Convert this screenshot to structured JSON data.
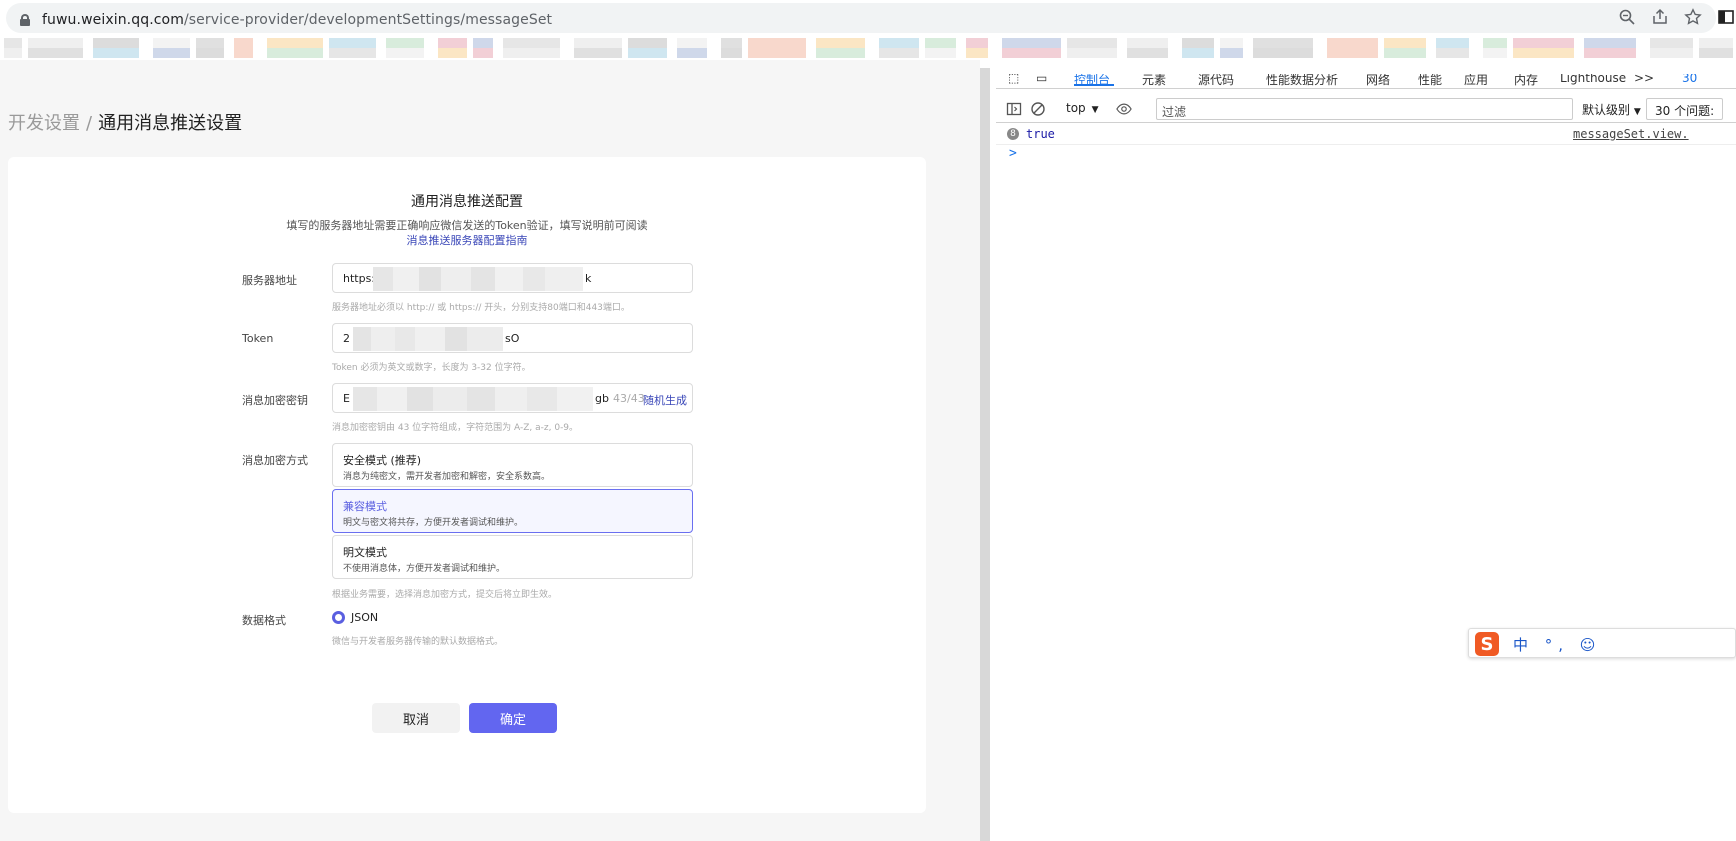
{
  "browser": {
    "url_host": "fuwu.weixin.qq.com",
    "url_path": "/service-provider/developmentSettings/messageSet"
  },
  "breadcrumb": {
    "parent": "开发设置",
    "separator": "/",
    "current": "通用消息推送设置"
  },
  "card": {
    "title": "通用消息推送配置",
    "subtitle": "填写的服务器地址需要正确响应微信发送的Token验证，填写说明前可阅读",
    "guide_link": "消息推送服务器配置指南"
  },
  "fields": {
    "server": {
      "label": "服务器地址",
      "value_start": "https:",
      "value_end": "k",
      "help": "服务器地址必须以 http:// 或 https:// 开头，分别支持80端口和443端口。"
    },
    "token": {
      "label": "Token",
      "value_start": "2",
      "value_end": "sO",
      "help": "Token 必须为英文或数字，长度为 3-32 位字符。"
    },
    "aes_key": {
      "label": "消息加密密钥",
      "value_start": "E",
      "value_end": "gb",
      "counter": "43/43",
      "generate": "随机生成",
      "help": "消息加密密钥由 43 位字符组成，字符范围为 A-Z, a-z, 0-9。"
    },
    "encrypt_mode": {
      "label": "消息加密方式",
      "options": [
        {
          "title": "安全模式 (推荐)",
          "desc": "消息为纯密文，需开发者加密和解密，安全系数高。"
        },
        {
          "title": "兼容模式",
          "desc": "明文与密文将共存，方便开发者调试和维护。"
        },
        {
          "title": "明文模式",
          "desc": "不使用消息体，方便开发者调试和维护。"
        }
      ],
      "selected_index": 1,
      "help": "根据业务需要，选择消息加密方式，提交后将立即生效。"
    },
    "data_format": {
      "label": "数据格式",
      "option": "JSON",
      "help": "微信与开发者服务器传输的默认数据格式。"
    }
  },
  "buttons": {
    "cancel": "取消",
    "ok": "确定"
  },
  "devtools": {
    "tabs": [
      "控制台",
      "元素",
      "源代码",
      "性能数据分析",
      "网络",
      "性能",
      "应用",
      "内存",
      "Lighthouse",
      ">>"
    ],
    "active_tab": "控制台",
    "issue_badge": "30",
    "context": "top",
    "filter_placeholder": "过滤",
    "level": "默认级别",
    "issues": "30 个问题:",
    "log_count": "8",
    "log_value": "true",
    "log_source": "messageSet.view.",
    "prompt": ">"
  },
  "ime": {
    "logo": "S",
    "text": "中 °, ☺"
  },
  "colors": {
    "accent": "#6266f0",
    "link": "#3a47b8",
    "devtools_active": "#1a73e8"
  }
}
